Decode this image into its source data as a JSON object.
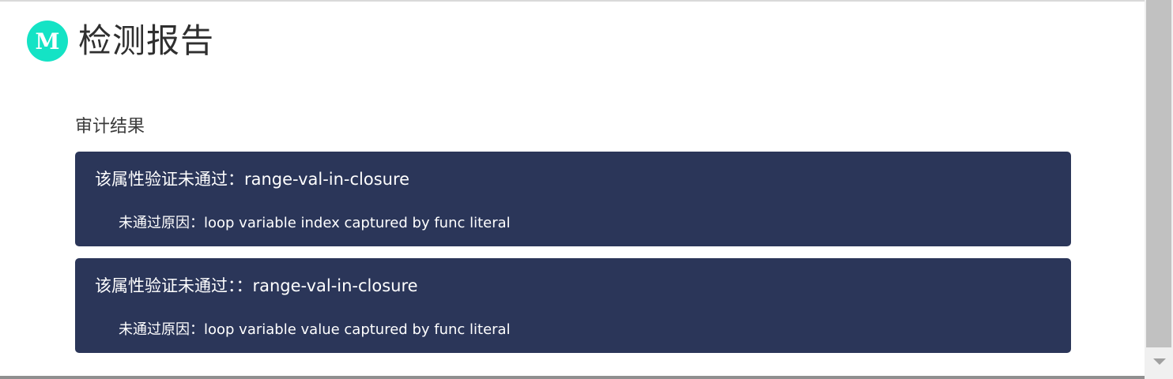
{
  "header": {
    "logo_letter": "M",
    "title": "检测报告"
  },
  "audit": {
    "section_title": "审计结果",
    "results": [
      {
        "heading": "该属性验证未通过：range-val-in-closure",
        "reason": "未通过原因：loop variable index captured by func literal"
      },
      {
        "heading": "该属性验证未通过：：range-val-in-closure",
        "reason": "未通过原因：loop variable value captured by func literal"
      }
    ]
  },
  "colors": {
    "logo_bg": "#14e3c5",
    "card_bg": "#2b3659",
    "card_text": "#ffffff",
    "title_text": "#2f2f2f"
  },
  "icons": {
    "logo": "m-logo-icon",
    "scroll_down": "chevron-down-icon"
  }
}
